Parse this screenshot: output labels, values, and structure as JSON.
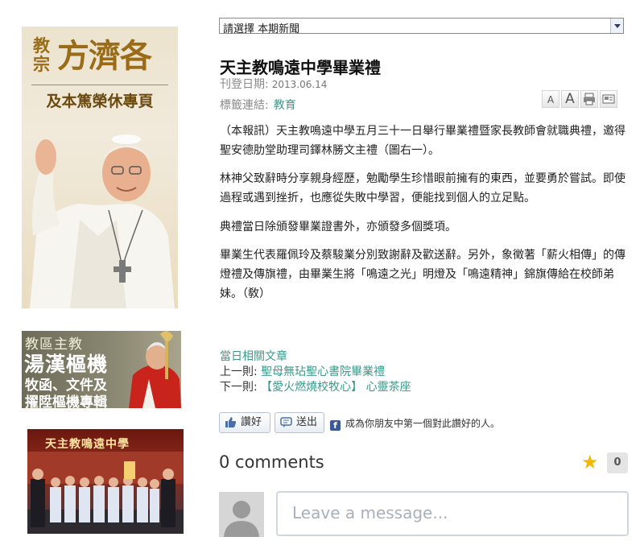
{
  "sidebar": {
    "pope_banner": {
      "small_text": "教宗",
      "big_text": "方濟各",
      "sub_text": "及本篤榮休專頁"
    },
    "bishop_banner": {
      "line1": "教區主教",
      "line2": "湯漢樞機",
      "line3": "牧函、文件及",
      "line4": "擢陞樞機專輯"
    },
    "school_photo": {
      "caption": "天主教鳴遠中學"
    }
  },
  "news_select": {
    "value": "請選擇 本期新聞"
  },
  "article": {
    "title": "天主教鳴遠中學畢業禮",
    "date_label": "刊登日期:",
    "date_value": "2013.06.14",
    "tag_label": "標籤連結:",
    "tag_value": "教育",
    "paragraphs": [
      "（本報訊）天主教鳴遠中學五月三十一日舉行畢業禮暨家長教師會就職典禮，邀得聖安德肋堂助理司鐸林勝文主禮（圖右一）。",
      "林神父致辭時分享親身經歷，勉勵學生珍惜眼前擁有的東西，並要勇於嘗試。即使過程或遇到挫折，也應從失敗中學習，便能找到個人的立足點。",
      "典禮當日除頒發畢業證書外，亦頒發多個獎項。",
      "畢業生代表羅佩玲及蔡駿業分別致謝辭及歡送辭。另外，象徵著「薪火相傳」的傳燈禮及傳旗禮，由畢業生將「鳴遠之光」明燈及「鳴遠精神」錦旗傳給在校師弟妹。（敎）"
    ]
  },
  "tools": {
    "font_small": "A",
    "font_large": "A"
  },
  "related": {
    "header": "當日相關文章",
    "prev_label": "上一則:",
    "prev_link": "聖母無玷聖心書院畢業禮",
    "next_label": "下一則:",
    "next_link": "【愛火燃燒校牧心】 心靈茶座"
  },
  "social": {
    "like_label": "讚好",
    "send_label": "送出",
    "fb_text": "成為你朋友中第一個對此讚好的人。"
  },
  "comments": {
    "count_text": "0 comments",
    "star_count": "0",
    "placeholder": "Leave a message..."
  },
  "colors": {
    "link_teal": "#3a9a8a",
    "star": "#f2b705",
    "facebook": "#3b5998"
  }
}
